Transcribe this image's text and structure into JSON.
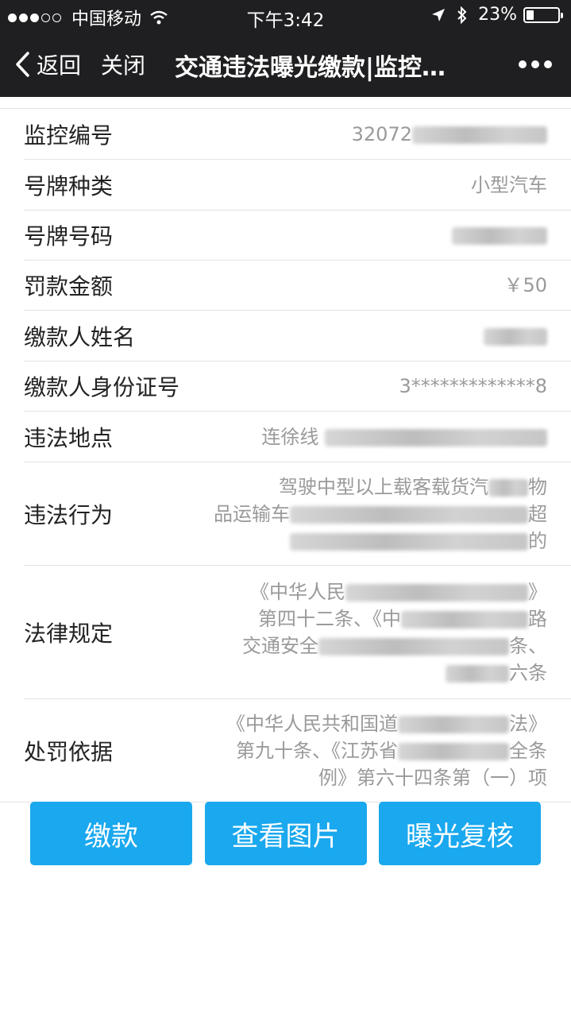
{
  "status_bar": {
    "carrier": "中国移动",
    "time": "下午3:42",
    "battery": "23%",
    "battery_level_percent": 23,
    "icons": [
      "wifi-icon",
      "location-arrow-icon",
      "bluetooth-icon",
      "battery-icon"
    ]
  },
  "nav": {
    "back_label": "返回",
    "close_label": "关闭",
    "title": "交通违法曝光缴款|监控…"
  },
  "rows": {
    "monitor_no": {
      "label": "监控编号",
      "value": "32072"
    },
    "plate_type": {
      "label": "号牌种类",
      "value": "小型汽车"
    },
    "plate_no": {
      "label": "号牌号码"
    },
    "fine": {
      "label": "罚款金额",
      "value": "￥50"
    },
    "payer_name": {
      "label": "缴款人姓名"
    },
    "payer_id": {
      "label": "缴款人身份证号",
      "value_start": "3",
      "value_stars": "*************",
      "value_end": "8"
    },
    "location": {
      "label": "违法地点",
      "value": "连徐线"
    },
    "behavior": {
      "label": "违法行为",
      "line1": "驾驶中型以上载客载货汽",
      "line1_tail": "物",
      "line2": "品运输车",
      "line2_tail": "超",
      "line3_tail": "的"
    },
    "law": {
      "label": "法律规定",
      "line1": "《中华人民",
      "line1_tail": "》",
      "line2": "第四十二条、《中",
      "line2_tail": "路",
      "line3": "交通安全",
      "line3_tail": "条、",
      "line4_tail": "六条"
    },
    "basis": {
      "label": "处罚依据",
      "line1": "《中华人民共和国道",
      "line1_tail": "法》",
      "line2": "第九十条、《江苏省",
      "line2_tail": "全条",
      "line3": "例》第六十四条第（一）项"
    }
  },
  "buttons": {
    "pay": "缴款",
    "view_photo": "查看图片",
    "review": "曝光复核"
  },
  "colors": {
    "header_bg": "#1f1f21",
    "button_bg": "#1aa8ee",
    "label_text": "#222222",
    "value_text": "#9a9a9a"
  }
}
